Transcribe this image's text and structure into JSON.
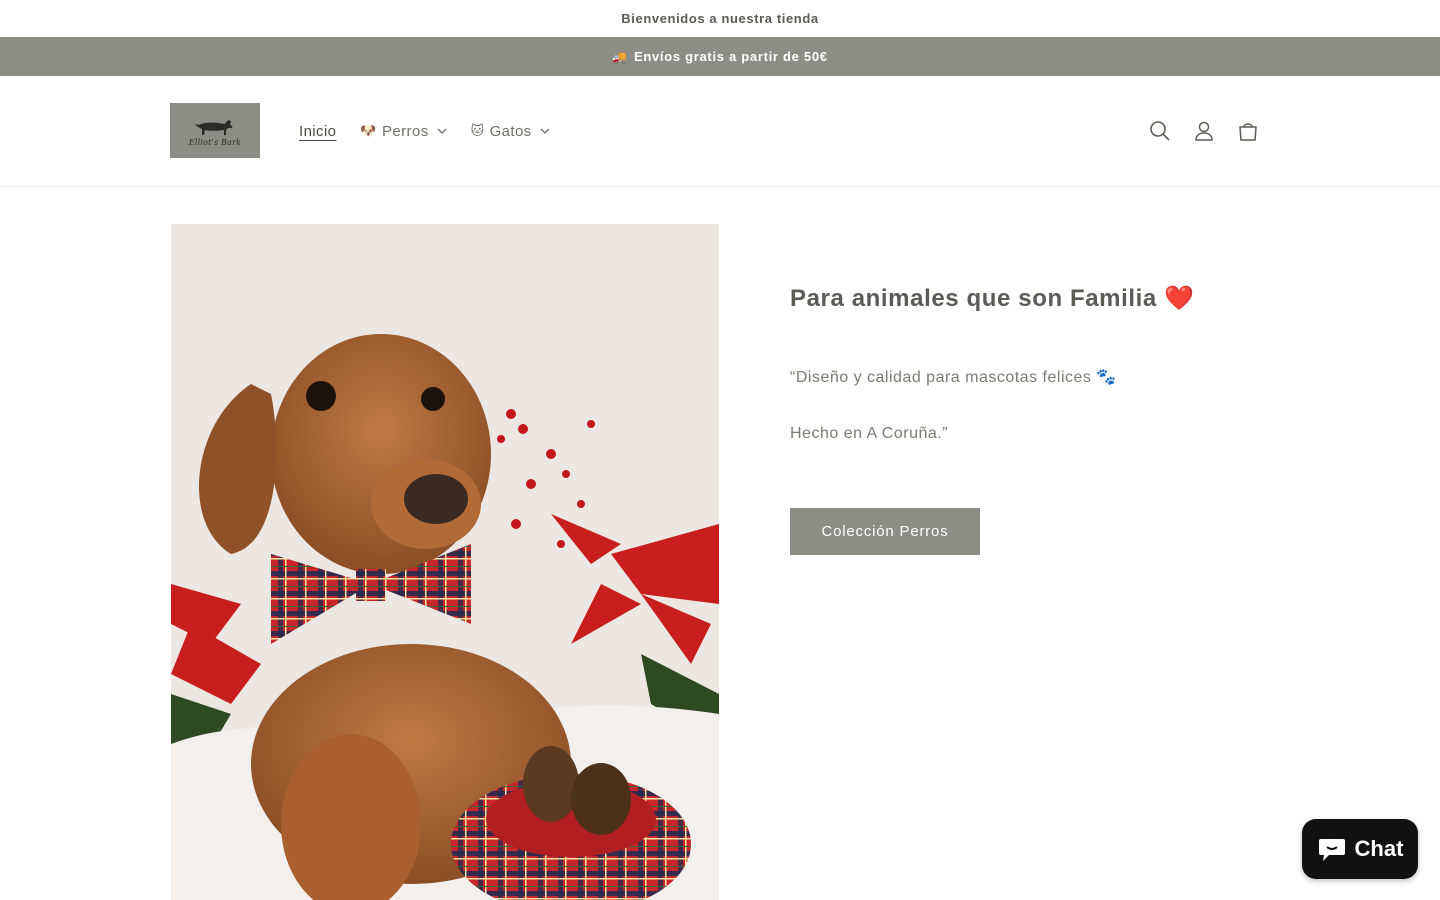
{
  "announcement": {
    "welcome": "Bienvenidos a nuestra tienda",
    "shipping_icon": "🚚",
    "shipping": "Envíos gratis a partir de 50€"
  },
  "header": {
    "logo_text": "Elliot's Bark",
    "nav": [
      {
        "label": "Inicio",
        "emoji": "",
        "active": true,
        "dropdown": false
      },
      {
        "label": "Perros",
        "emoji": "🐶",
        "active": false,
        "dropdown": true
      },
      {
        "label": "Gatos",
        "emoji": "🐱",
        "active": false,
        "dropdown": true
      }
    ],
    "icons": [
      "search-icon",
      "account-icon",
      "cart-icon"
    ]
  },
  "hero": {
    "title": "Para animales que son Familia",
    "title_emoji": "❤️",
    "description_line1": "“Diseño y calidad para mascotas felices 🐾",
    "description_line2": "Hecho en A Coruña.”",
    "button_label": "Colección Perros"
  },
  "chat": {
    "label": "Chat"
  },
  "colors": {
    "accent": "#8b8d86",
    "text": "#5b5b58",
    "chat_bg": "#111111"
  }
}
